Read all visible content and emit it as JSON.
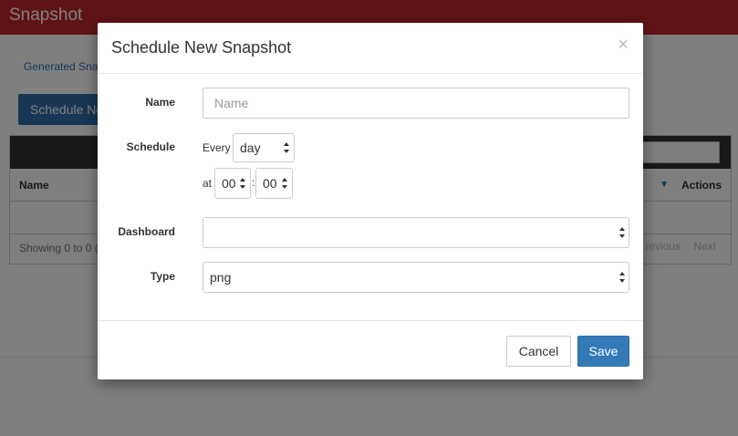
{
  "app": {
    "title": "Snapshot"
  },
  "background": {
    "tab_label": "Generated Sna",
    "schedule_button": "Schedule Ne",
    "table": {
      "col_name": "Name",
      "col_actions": "Actions",
      "footer": "Showing 0 to 0 (",
      "prev": "revious",
      "next": "Next"
    }
  },
  "modal": {
    "title": "Schedule New Snapshot",
    "close_symbol": "×",
    "name": {
      "label": "Name",
      "placeholder": "Name",
      "value": ""
    },
    "schedule": {
      "label": "Schedule",
      "every_text": "Every",
      "period": "day",
      "at_text": "at",
      "hour": "00",
      "separator": ":",
      "minute": "00"
    },
    "dashboard": {
      "label": "Dashboard",
      "value": ""
    },
    "type": {
      "label": "Type",
      "value": "png"
    },
    "cancel_label": "Cancel",
    "save_label": "Save"
  },
  "colors": {
    "topbar": "#c0262c",
    "primary": "#337ab7"
  }
}
